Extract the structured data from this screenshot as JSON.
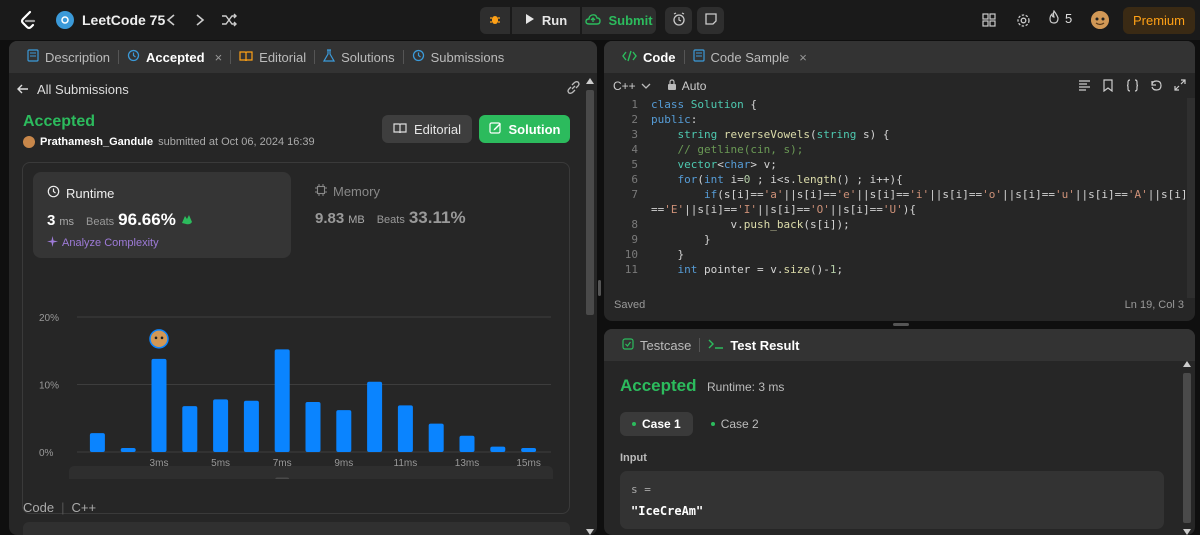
{
  "topbar": {
    "problem_list_title": "LeetCode 75",
    "run_label": "Run",
    "submit_label": "Submit",
    "streak_count": "5",
    "premium_label": "Premium"
  },
  "left_tabs": [
    {
      "label": "Description"
    },
    {
      "label": "Accepted"
    },
    {
      "label": "Editorial"
    },
    {
      "label": "Solutions"
    },
    {
      "label": "Submissions"
    }
  ],
  "submission": {
    "back_label": "All Submissions",
    "status": "Accepted",
    "user": "Prathamesh_Gandule",
    "submitted_text": "submitted at Oct 06, 2024 16:39",
    "editorial_btn": "Editorial",
    "solution_btn": "Solution"
  },
  "runtime": {
    "label": "Runtime",
    "value": "3",
    "unit": "ms",
    "beats_label": "Beats",
    "beats_value": "96.66%",
    "analyze_label": "Analyze Complexity"
  },
  "memory": {
    "label": "Memory",
    "value": "9.83",
    "unit": "MB",
    "beats_label": "Beats",
    "beats_value": "33.11%"
  },
  "chart_data": {
    "type": "bar",
    "categories": [
      "1ms",
      "2ms",
      "3ms",
      "4ms",
      "5ms",
      "6ms",
      "7ms",
      "8ms",
      "9ms",
      "10ms",
      "11ms",
      "12ms",
      "13ms",
      "14ms",
      "15ms"
    ],
    "tick_labels": [
      "3ms",
      "5ms",
      "7ms",
      "9ms",
      "11ms",
      "13ms",
      "15ms"
    ],
    "values": [
      2.8,
      0.6,
      13.8,
      6.8,
      7.8,
      7.6,
      15.2,
      7.4,
      6.2,
      10.4,
      6.9,
      4.2,
      2.4,
      0.8,
      0.6
    ],
    "y_ticks": [
      "0%",
      "10%",
      "20%"
    ],
    "ylim": [
      0,
      20
    ],
    "highlight_category": "3ms",
    "color": "#0a84ff",
    "grid": true
  },
  "code_section": {
    "label": "Code",
    "lang": "C++"
  },
  "right_tabs": {
    "code": "Code",
    "code_sample": "Code Sample"
  },
  "editor": {
    "language": "C++",
    "mode": "Auto",
    "status": "Saved",
    "cursor": "Ln 19, Col 3",
    "line_numbers": [
      "1",
      "2",
      "3",
      "4",
      "5",
      "6",
      "7",
      "8",
      "9",
      "10",
      "11"
    ]
  },
  "test_tabs": {
    "testcase": "Testcase",
    "test_result": "Test Result"
  },
  "test_result": {
    "status": "Accepted",
    "runtime": "Runtime: 3 ms",
    "cases": [
      "Case 1",
      "Case 2"
    ],
    "input_label": "Input",
    "input_name": "s =",
    "input_value": "\"IceCreAm\""
  },
  "colors": {
    "accent_green": "#2cbb5d",
    "premium": "#ffa116",
    "bar_blue": "#0a84ff"
  }
}
